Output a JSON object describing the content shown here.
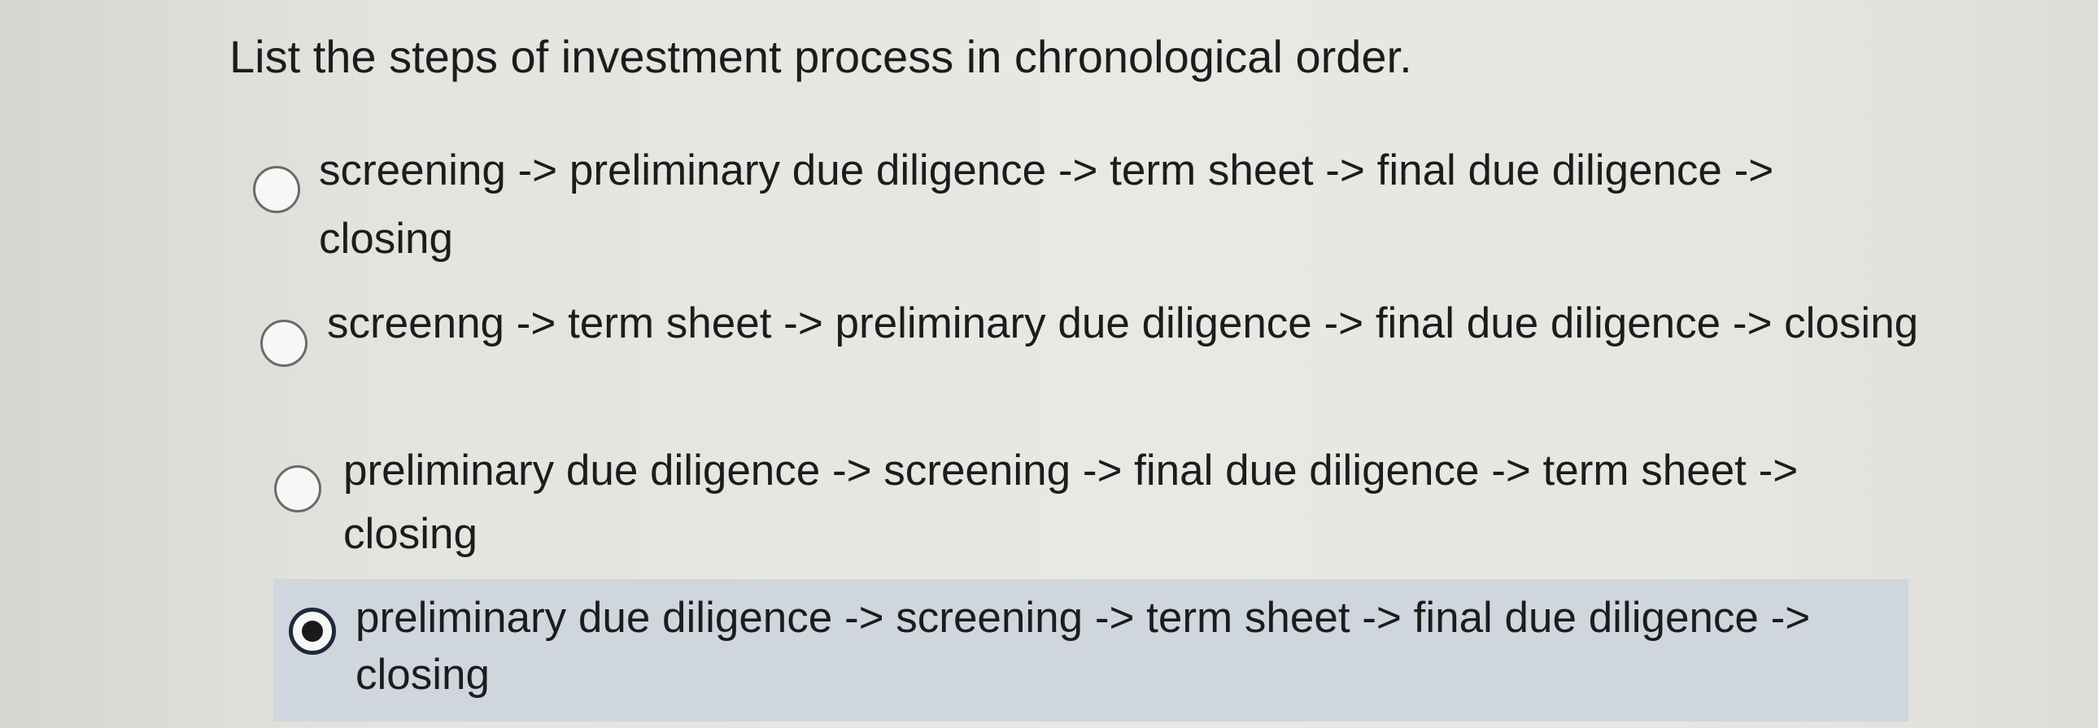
{
  "question": {
    "text": "List the steps of investment process in chronological order."
  },
  "options": [
    {
      "label": "screening -> preliminary due diligence -> term sheet -> final due diligence -> closing",
      "selected": false
    },
    {
      "label": "screenng -> term sheet -> preliminary due diligence -> final due diligence -> closing",
      "selected": false
    },
    {
      "label": "preliminary due diligence -> screening -> final due diligence -> term sheet -> closing",
      "selected": false
    },
    {
      "label": "preliminary due diligence -> screening -> term sheet -> final due diligence -> closing",
      "selected": true
    }
  ],
  "colors": {
    "selected_highlight": "#cfd6dd",
    "text": "#1c1c1c",
    "radio_border": "#6b6b6b"
  }
}
